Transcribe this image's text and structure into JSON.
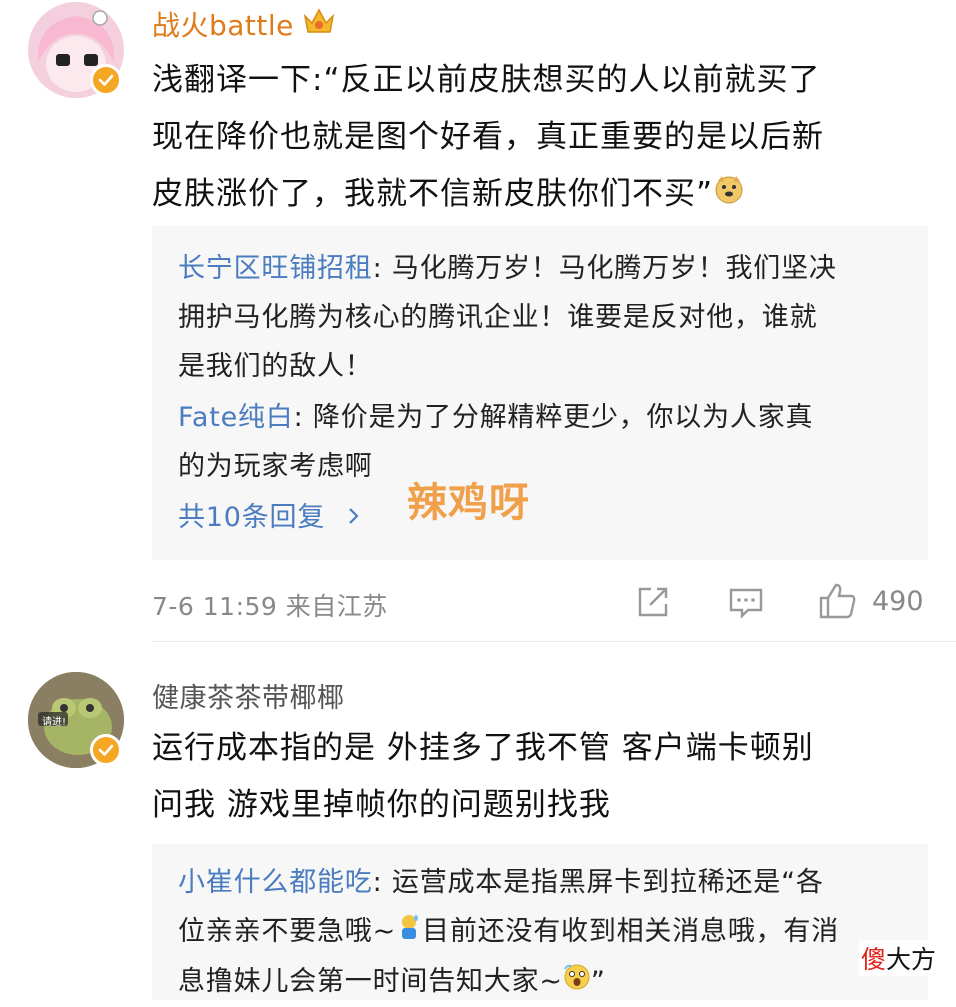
{
  "comments": [
    {
      "username": "战火battle",
      "text_line1": "浅翻译一下:“反正以前皮肤想买的人以前就买了",
      "text_line2": "现在降价也就是图个好看，真正重要的是以后新",
      "text_line3": "皮肤涨价了，我就不信新皮肤你们不买”",
      "replies": [
        {
          "name": "长宁区旺铺招租",
          "line1": "马化腾万岁！马化腾万岁！我们坚决",
          "line2": "拥护马化腾为核心的腾讯企业！谁要是反对他，谁就",
          "line3": "是我们的敌人！"
        },
        {
          "name": "Fate纯白",
          "line1": "降价是为了分解精粹更少，你以为人家真",
          "line2": "的为玩家考虑啊"
        }
      ],
      "more_replies": "共10条回复",
      "overlay_text": "辣鸡呀",
      "timestamp": "7-6 11:59 来自江苏",
      "likes": "490"
    },
    {
      "username": "健康茶茶带椰椰",
      "text_line1": "运行成本指的是 外挂多了我不管 客户端卡顿别",
      "text_line2": "问我 游戏里掉帧你的问题别找我",
      "avatar_text": "请进!",
      "replies": [
        {
          "name": "小崔什么都能吃",
          "line1": "运营成本是指黑屏卡到拉稀还是“各",
          "line2": "位亲亲不要急哦~",
          "line2b": "目前还没有收到相关消息哦，有消",
          "line3": "息撸妹儿会第一时间告知大家~",
          "line3b": "”"
        }
      ]
    }
  ],
  "watermark_red": "傻",
  "watermark_black": "大方",
  "colors": {
    "link": "#4a7cbf",
    "username": "#e07b1a",
    "badge": "#f5a623",
    "overlay": "#f0a04b"
  }
}
